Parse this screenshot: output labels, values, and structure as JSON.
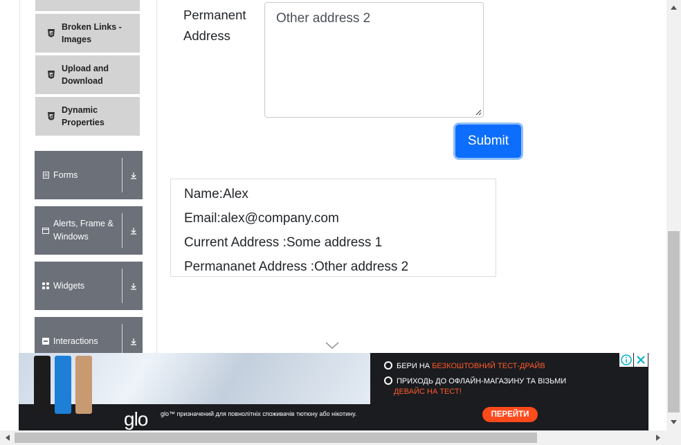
{
  "sidebar": {
    "sub_items": [
      {
        "label": "Broken Links - Images",
        "icon": "html5-icon"
      },
      {
        "label": "Upload and Download",
        "icon": "html5-icon"
      },
      {
        "label": "Dynamic Properties",
        "icon": "html5-icon"
      }
    ],
    "groups": [
      {
        "label": "Forms",
        "icon": "form-icon"
      },
      {
        "label": "Alerts, Frame & Windows",
        "icon": "window-icon"
      },
      {
        "label": "Widgets",
        "icon": "widgets-icon"
      },
      {
        "label": "Interactions",
        "icon": "interactions-icon"
      }
    ]
  },
  "form": {
    "permanent_address_label": "Permanent Address",
    "permanent_address_value": "Other address 2",
    "submit_label": "Submit"
  },
  "output": {
    "name": "Name:Alex",
    "email": "Email:alex@company.com",
    "current_address": "Current Address :Some address 1",
    "permanent_address": "Permananet Address :Other address 2"
  },
  "ad": {
    "line1_prefix": "БЕРИ НА",
    "line1_accent": "БЕЗКОШТОВНИЙ ТЕСТ-ДРАЙВ",
    "line2": "ПРИХОДЬ ДО ОФЛАЙН-МАГАЗИНУ ТА ВІЗЬМИ",
    "line2_accent": "ДЕВАЙС НА ТЕСТ!",
    "logo": "glo",
    "disclaimer": "glo™ призначений для повнолітніх споживачів тютюну або нікотину.",
    "cta": "ПЕРЕЙТИ"
  },
  "colors": {
    "primary": "#0d6efd",
    "sidebar_group": "#6b7079",
    "sidebar_subitem": "#d3d3d3",
    "ad_accent": "#ff5a28"
  }
}
